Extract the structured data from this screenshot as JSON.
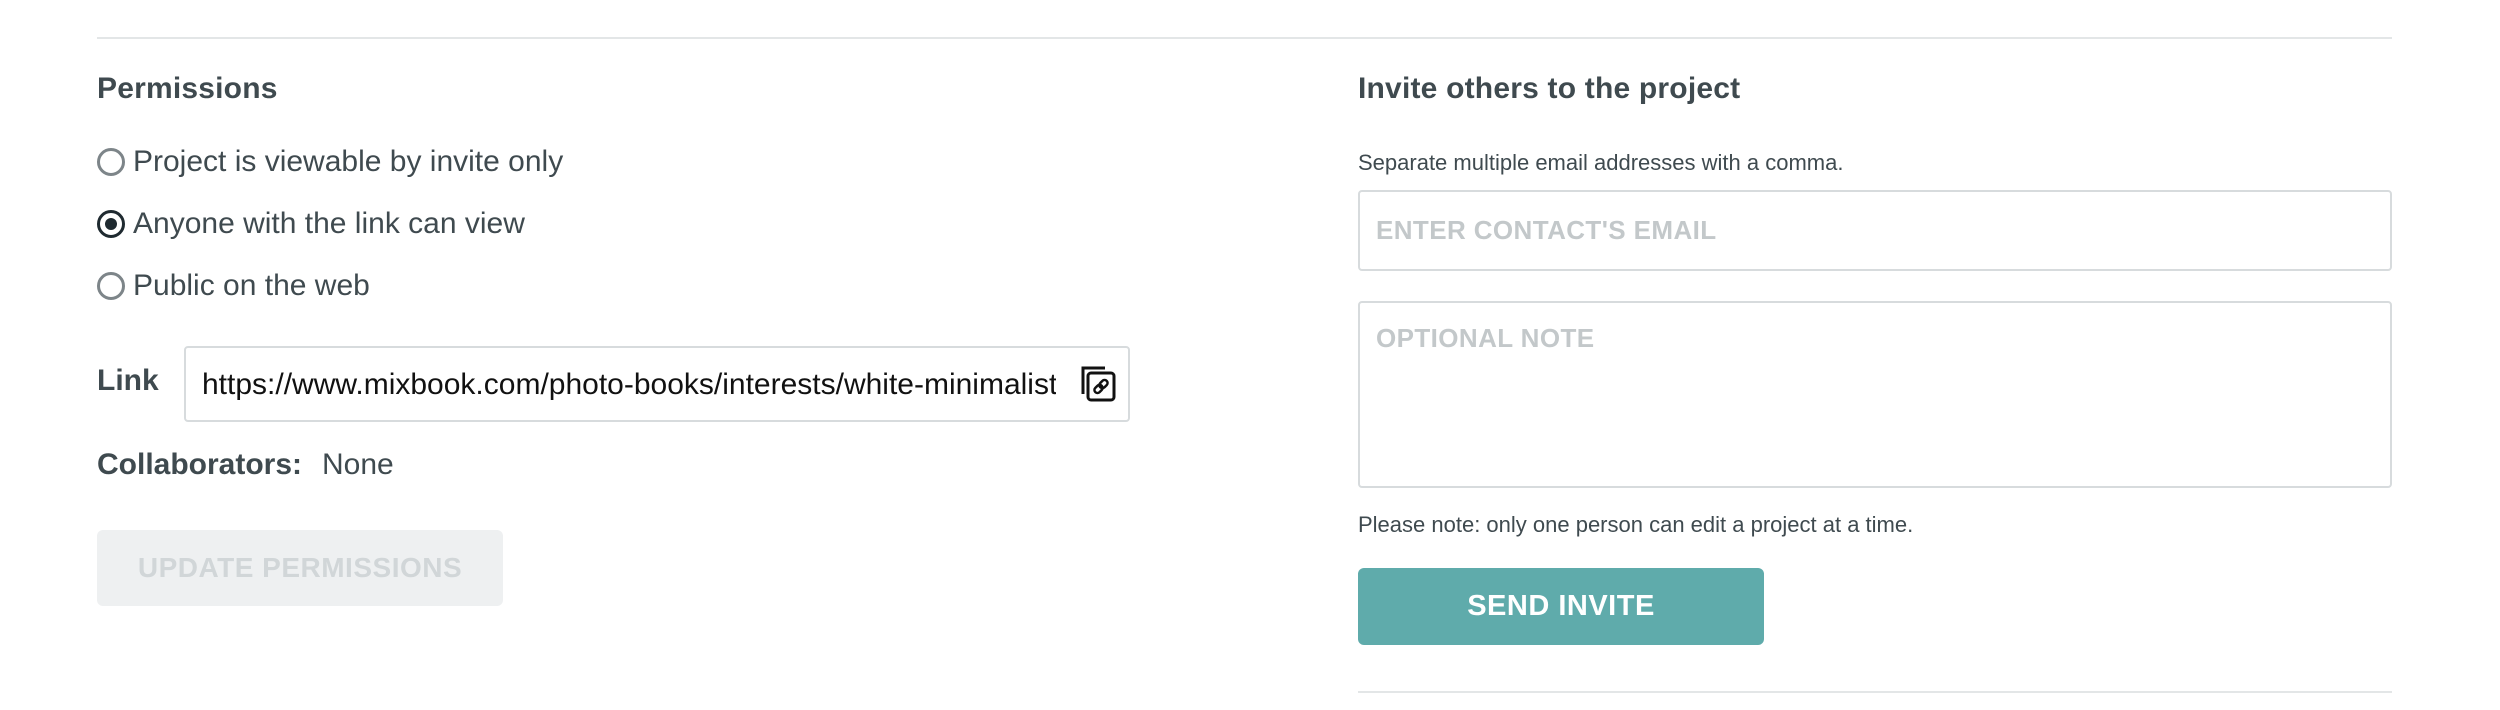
{
  "permissions": {
    "title": "Permissions",
    "options": [
      {
        "label": "Project is viewable by invite only",
        "checked": false
      },
      {
        "label": "Anyone with the link can view",
        "checked": true
      },
      {
        "label": "Public on the web",
        "checked": false
      }
    ],
    "link_label": "Link",
    "link_value": "https://www.mixbook.com/photo-books/interests/white-minimalist",
    "collaborators_label": "Collaborators:",
    "collaborators_value": "None",
    "update_button": "UPDATE PERMISSIONS"
  },
  "invite": {
    "title": "Invite others to the project",
    "hint": "Separate multiple email addresses with a comma.",
    "email_placeholder": "ENTER CONTACT'S EMAIL",
    "note_placeholder": "OPTIONAL NOTE",
    "edit_note": "Please note: only one person can edit a project at a time.",
    "send_button": "SEND INVITE"
  },
  "colors": {
    "accent": "#5fabab",
    "text": "#3f4a4f",
    "disabled_bg": "#eef0f1",
    "disabled_text": "#d1d6d8"
  },
  "icons": {
    "copy": "copy-link-icon"
  }
}
